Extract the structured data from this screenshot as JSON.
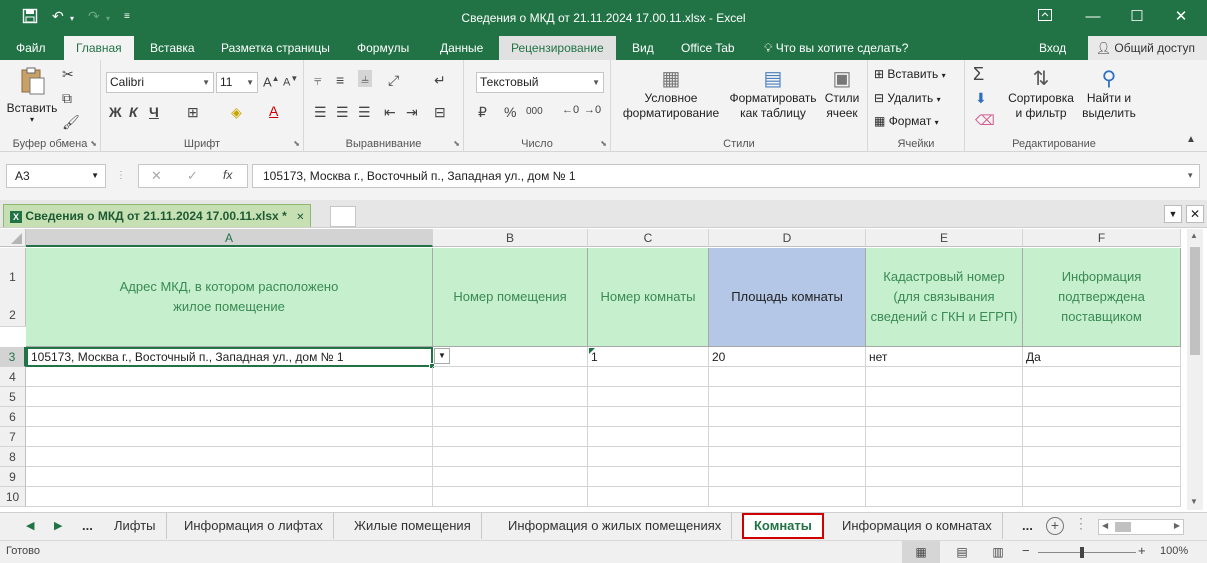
{
  "window": {
    "title": "Сведения о МКД от 21.11.2024 17.00.11.xlsx - Excel",
    "controls": [
      "ribbon-display",
      "minimize",
      "maximize",
      "close"
    ]
  },
  "tabs": {
    "items": [
      "Файл",
      "Главная",
      "Вставка",
      "Разметка страницы",
      "Формулы",
      "Данные",
      "Рецензирование",
      "Вид",
      "Office Tab"
    ],
    "active": "Главная",
    "tell_me": "Что вы хотите сделать?",
    "signin": "Вход",
    "share": "Общий доступ"
  },
  "ribbon": {
    "clipboard": {
      "paste": "Вставить",
      "label": "Буфер обмена"
    },
    "font": {
      "name": "Calibri",
      "size": "11",
      "label": "Шрифт",
      "bold": "Ж",
      "italic": "К",
      "underline": "Ч"
    },
    "alignment": {
      "label": "Выравнивание"
    },
    "number": {
      "format": "Текстовый",
      "label": "Число",
      "currency": "₽",
      "percent": "%",
      "thousands": "000"
    },
    "styles": {
      "conditional": "Условное форматирование",
      "table": "Форматировать как таблицу",
      "cell": "Стили ячеек",
      "label": "Стили"
    },
    "cells": {
      "insert": "Вставить",
      "delete": "Удалить",
      "format": "Формат",
      "label": "Ячейки"
    },
    "editing": {
      "sort": "Сортировка и фильтр",
      "find": "Найти и выделить",
      "label": "Редактирование"
    }
  },
  "formula_bar": {
    "name_box": "A3",
    "fx": "fx",
    "value": "105173, Москва г., Восточный п., Западная ул., дом № 1"
  },
  "workbook_tab": {
    "name": "Сведения о МКД от 21.11.2024 17.00.11.xlsx *"
  },
  "grid": {
    "columns": [
      "A",
      "B",
      "C",
      "D",
      "E",
      "F"
    ],
    "rows": [
      "1",
      "2",
      "3",
      "4",
      "5",
      "6",
      "7",
      "8",
      "9",
      "10"
    ],
    "headers": [
      "Адрес МКД, в котором расположено жилое помещение",
      "Номер помещения",
      "Номер комнаты",
      "Площадь комнаты",
      "Кадастровый номер (для связывания сведений с ГКН и ЕГРП)",
      "Информация подтверждена поставщиком"
    ],
    "row3": [
      "105173, Москва г., Восточный п., Западная ул., дом № 1",
      "",
      "1",
      "20",
      "нет",
      "Да"
    ],
    "active_cell": "A3"
  },
  "sheets": {
    "items": [
      "...",
      "Лифты",
      "Информация о лифтах",
      "Жилые помещения",
      "Информация о жилых помещениях",
      "Комнаты",
      "Информация о комнатах",
      "..."
    ],
    "active": "Комнаты"
  },
  "status": {
    "text": "Готово",
    "zoom": "100%"
  },
  "colors": {
    "accent": "#217346",
    "header_fill": "#c6efce",
    "header_selected_fill": "#b4c7e7",
    "highlight_border": "#d00000"
  }
}
